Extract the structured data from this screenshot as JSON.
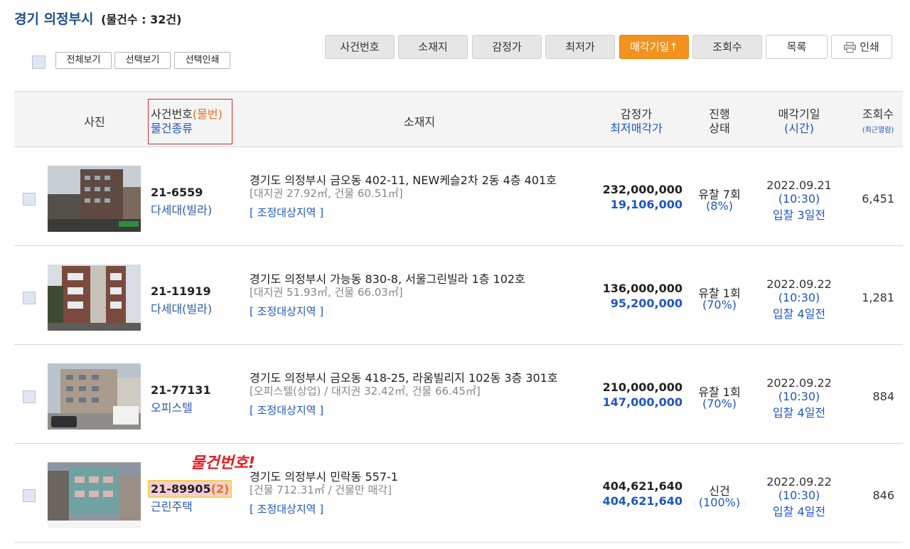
{
  "header": {
    "title": "경기 의정부시",
    "count": "(물건수 : 32건)"
  },
  "selection_buttons": [
    "전체보기",
    "선택보기",
    "선택인쇄"
  ],
  "sort_buttons": [
    {
      "label": "사건번호"
    },
    {
      "label": "소재지"
    },
    {
      "label": "감정가"
    },
    {
      "label": "최저가"
    },
    {
      "label": "매각기일↑",
      "active": true
    },
    {
      "label": "조회수"
    },
    {
      "label": "목록"
    },
    {
      "label": "인쇄"
    }
  ],
  "columns": {
    "photo": "사진",
    "case": "사건번호",
    "case_sub": "(물번)",
    "kind": "물건종류",
    "location": "소재지",
    "appraisal": "감정가",
    "min_price": "최저매각가",
    "status1": "진행",
    "status2": "상태",
    "date": "매각기일",
    "time": "(시간)",
    "views": "조회수",
    "views_sub": "(최근열람)"
  },
  "rows": [
    {
      "case_no": "21-6559",
      "kind": "다세대(빌라)",
      "address": "경기도 의정부시 금오동 402-11, NEW케슬2차 2동 4층 401호",
      "detail": "[대지권 27.92㎡, 건물 60.51㎡]",
      "zone": "[ 조정대상지역 ]",
      "appraisal": "232,000,000",
      "min_price": "19,106,000",
      "status": "유찰 7회",
      "status_pct": "(8%)",
      "date": "2022.09.21",
      "time": "(10:30)",
      "dday": "입찰 3일전",
      "views": "6,451"
    },
    {
      "case_no": "21-11919",
      "kind": "다세대(빌라)",
      "address": "경기도 의정부시 가능동 830-8, 서울그린빌라 1층 102호",
      "detail": "[대지권 51.93㎡, 건물 66.03㎡]",
      "zone": "[ 조정대상지역 ]",
      "appraisal": "136,000,000",
      "min_price": "95,200,000",
      "status": "유찰 1회",
      "status_pct": "(70%)",
      "date": "2022.09.22",
      "time": "(10:30)",
      "dday": "입찰 4일전",
      "views": "1,281"
    },
    {
      "case_no": "21-77131",
      "kind": "오피스텔",
      "address": "경기도 의정부시 금오동 418-25, 라움빌리지 102동 3층 301호",
      "detail": "[오피스텔(상업) / 대지권 32.42㎡, 건물 66.45㎡]",
      "zone": "[ 조정대상지역 ]",
      "appraisal": "210,000,000",
      "min_price": "147,000,000",
      "status": "유찰 1회",
      "status_pct": "(70%)",
      "date": "2022.09.22",
      "time": "(10:30)",
      "dday": "입찰 4일전",
      "views": "884"
    },
    {
      "case_no": "21-89905",
      "case_sub": "(2)",
      "kind": "근린주택",
      "address": "경기도 의정부시 민락동 557-1",
      "detail": "[건물 712.31㎡ / 건물만 매각]",
      "zone": "[ 조정대상지역 ]",
      "appraisal": "404,621,640",
      "min_price": "404,621,640",
      "status": "신건",
      "status_pct": "(100%)",
      "date": "2022.09.22",
      "time": "(10:30)",
      "dday": "입찰 4일전",
      "views": "846"
    }
  ],
  "annotation": "물건번호!"
}
